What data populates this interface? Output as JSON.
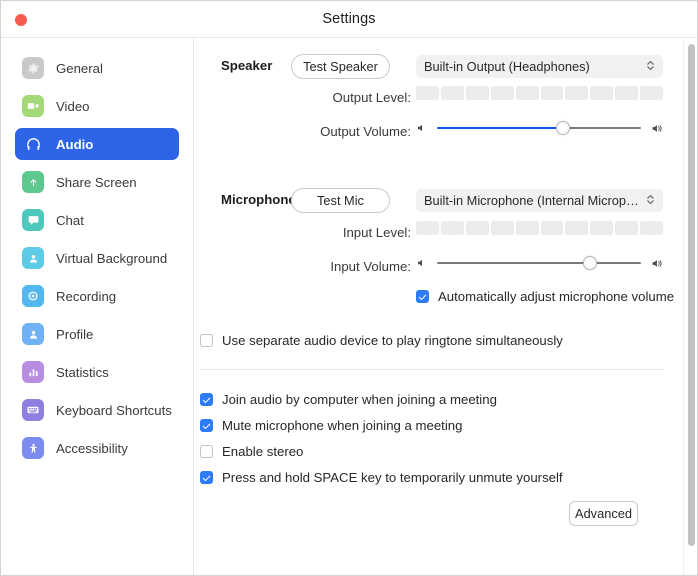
{
  "window": {
    "title": "Settings",
    "close_button": "close",
    "accent_color": "#2d64e8",
    "close_color": "#f35b50"
  },
  "sidebar": {
    "items": [
      {
        "label": "General",
        "icon": "gear-icon",
        "icon_color": "#c9c9cc",
        "active": false
      },
      {
        "label": "Video",
        "icon": "video-camera-icon",
        "icon_color": "#a3d977",
        "active": false
      },
      {
        "label": "Audio",
        "icon": "headphones-icon",
        "icon_color": "#2d64e8",
        "active": true
      },
      {
        "label": "Share Screen",
        "icon": "share-screen-icon",
        "icon_color": "#5ec98f",
        "active": false
      },
      {
        "label": "Chat",
        "icon": "chat-bubble-icon",
        "icon_color": "#4ec8bd",
        "active": false
      },
      {
        "label": "Virtual Background",
        "icon": "person-frame-icon",
        "icon_color": "#5ccbe8",
        "active": false
      },
      {
        "label": "Recording",
        "icon": "record-circle-icon",
        "icon_color": "#54b8f0",
        "active": false
      },
      {
        "label": "Profile",
        "icon": "person-icon",
        "icon_color": "#6fb2f5",
        "active": false
      },
      {
        "label": "Statistics",
        "icon": "bar-chart-icon",
        "icon_color": "#b78de0",
        "active": false
      },
      {
        "label": "Keyboard Shortcuts",
        "icon": "keyboard-icon",
        "icon_color": "#8e7fe0",
        "active": false
      },
      {
        "label": "Accessibility",
        "icon": "accessibility-icon",
        "icon_color": "#7b8bf0",
        "active": false
      }
    ]
  },
  "main": {
    "speaker": {
      "section_label": "Speaker",
      "test_button": "Test Speaker",
      "device": "Built-in Output (Headphones)",
      "output_level_label": "Output Level:",
      "output_level_segments": 10,
      "output_level_value": 0,
      "output_volume_label": "Output Volume:",
      "output_volume_value": 62,
      "output_volume_filled": true,
      "low_icon": "speaker-low-icon",
      "high_icon": "speaker-high-icon"
    },
    "microphone": {
      "section_label": "Microphone",
      "test_button": "Test Mic",
      "device": "Built-in Microphone (Internal Micropho...",
      "input_level_label": "Input Level:",
      "input_level_segments": 10,
      "input_level_value": 0,
      "input_volume_label": "Input Volume:",
      "input_volume_value": 75,
      "input_volume_filled": false,
      "low_icon": "mic-low-icon",
      "high_icon": "mic-high-icon",
      "auto_adjust": {
        "label": "Automatically adjust microphone volume",
        "checked": true
      }
    },
    "ringtone_option": {
      "label": "Use separate audio device to play ringtone simultaneously",
      "checked": false
    },
    "meeting_options": [
      {
        "label": "Join audio by computer when joining a meeting",
        "checked": true
      },
      {
        "label": "Mute microphone when joining a meeting",
        "checked": true
      },
      {
        "label": "Enable stereo",
        "checked": false
      },
      {
        "label": "Press and hold SPACE key to temporarily unmute yourself",
        "checked": true
      }
    ],
    "advanced_button": "Advanced"
  }
}
